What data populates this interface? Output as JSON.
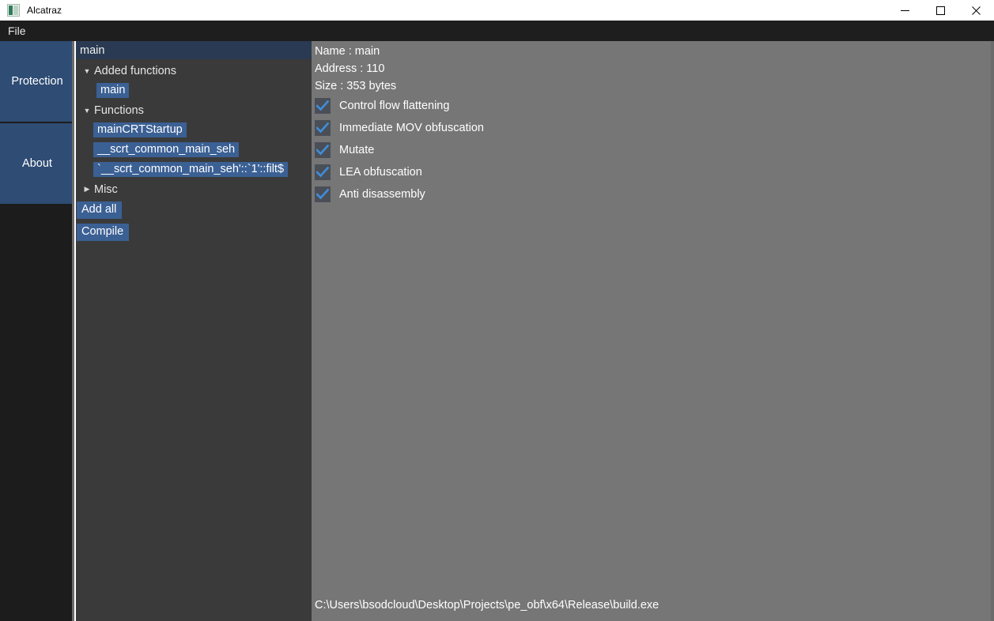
{
  "window": {
    "title": "Alcatraz",
    "icon": "app-icon",
    "controls": [
      {
        "name": "minimize",
        "glyph": "minimize-icon"
      },
      {
        "name": "maximize",
        "glyph": "maximize-icon"
      },
      {
        "name": "close",
        "glyph": "close-icon"
      }
    ]
  },
  "menubar": {
    "items": [
      {
        "label": "File"
      }
    ]
  },
  "sidebar": {
    "items": [
      {
        "label": "Protection",
        "selected": true
      },
      {
        "label": "About",
        "selected": false
      }
    ]
  },
  "tree": {
    "header": "main",
    "nodes": [
      {
        "type": "group",
        "label": "Added functions",
        "expanded": true,
        "arrow": "▼"
      },
      {
        "type": "leaf",
        "label": "main"
      },
      {
        "type": "group",
        "label": "Functions",
        "expanded": true,
        "arrow": "▼"
      },
      {
        "type": "leaf",
        "label": "mainCRTStartup"
      },
      {
        "type": "leaf",
        "label": "__scrt_common_main_seh"
      },
      {
        "type": "leaf",
        "label": "`__scrt_common_main_seh'::`1'::filt$"
      },
      {
        "type": "group",
        "label": "Misc",
        "expanded": false,
        "arrow": "▶"
      }
    ],
    "buttons": [
      {
        "label": "Add all"
      },
      {
        "label": "Compile"
      }
    ]
  },
  "detail": {
    "info": [
      "Name : main",
      "Address : 110",
      "Size : 353 bytes"
    ],
    "options": [
      {
        "label": "Control flow flattening",
        "checked": true
      },
      {
        "label": "Immediate MOV obfuscation",
        "checked": true
      },
      {
        "label": "Mutate",
        "checked": true
      },
      {
        "label": "LEA obfuscation",
        "checked": true
      },
      {
        "label": "Anti disassembly",
        "checked": true
      }
    ],
    "path": "C:\\Users\\bsodcloud\\Desktop\\Projects\\pe_obf\\x64\\Release\\build.exe"
  },
  "colors": {
    "accent_blue": "#3b6094",
    "sidebar_selected": "#2e4c74",
    "tree_header": "#2a3a52",
    "tree_bg": "#3a3a3a",
    "detail_bg": "#767676",
    "menubar_bg": "#1e1e1e",
    "check_blue": "#3f8edc"
  }
}
